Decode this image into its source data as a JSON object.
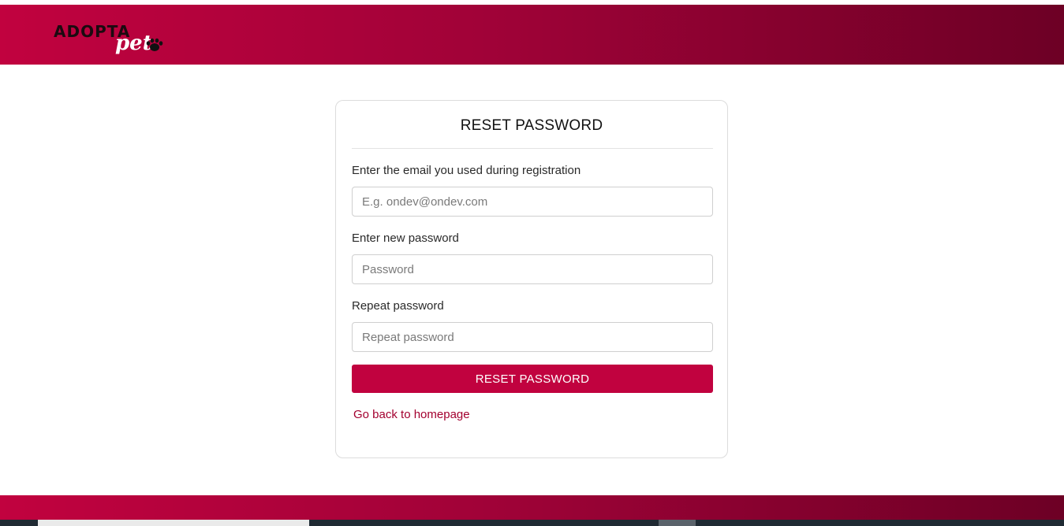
{
  "header": {
    "logo_main": "ADOPTA",
    "logo_sub": "pet"
  },
  "form": {
    "title": "RESET PASSWORD",
    "email_label": "Enter the email you used during registration",
    "email_placeholder": "E.g. ondev@ondev.com",
    "new_password_label": "Enter new password",
    "new_password_placeholder": "Password",
    "repeat_password_label": "Repeat password",
    "repeat_password_placeholder": "Repeat password",
    "submit_label": "RESET PASSWORD",
    "back_link": "Go back to homepage"
  },
  "colors": {
    "brand": "#c1023f",
    "brand_dark": "#6d0025",
    "link": "#a3002f"
  },
  "icons": [
    "paw-icon"
  ]
}
